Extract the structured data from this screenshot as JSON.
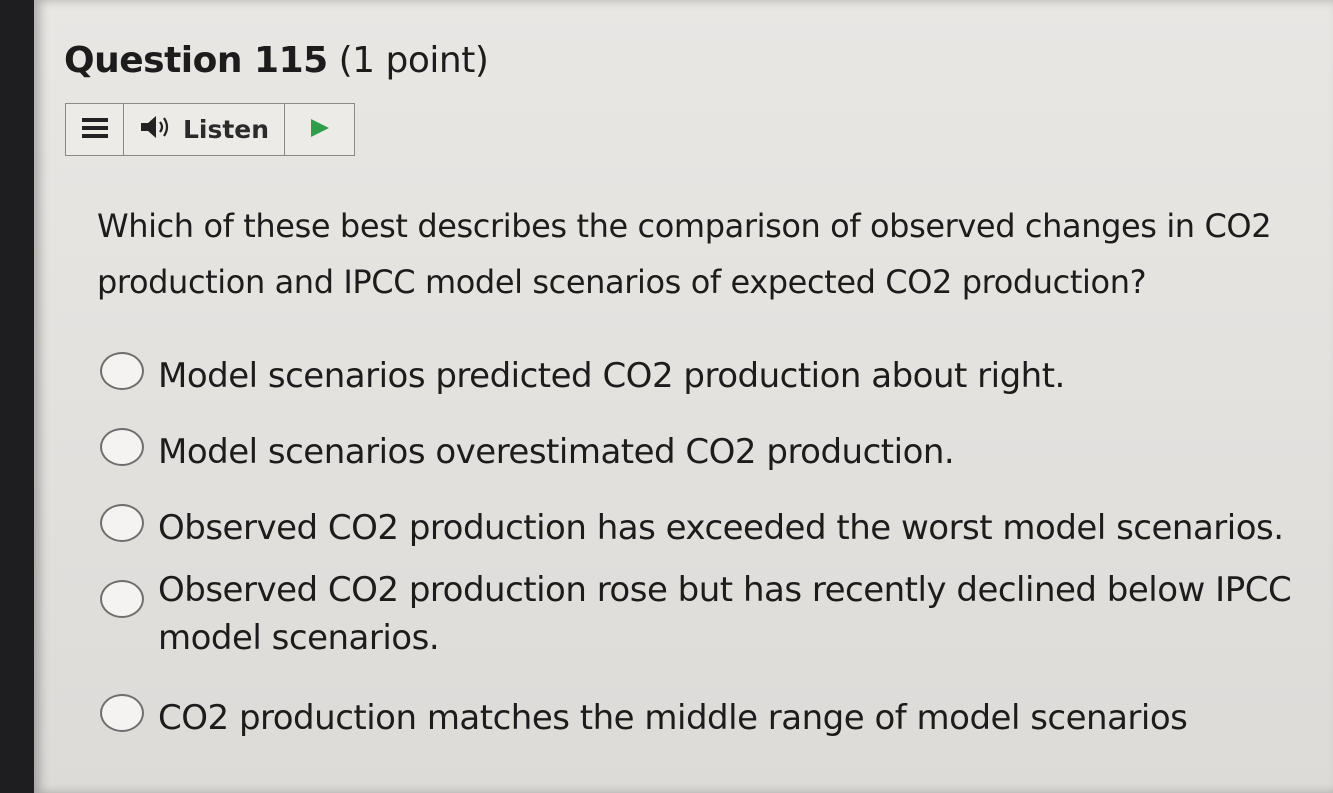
{
  "question": {
    "title": "Question 115",
    "points": "(1 point)",
    "text": "Which of these best describes the comparison of observed changes in CO2 production and IPCC model scenarios of expected CO2 production?"
  },
  "toolbar": {
    "listen_label": "Listen"
  },
  "options": [
    "Model scenarios predicted CO2 production about right.",
    "Model scenarios overestimated CO2 production.",
    "Observed CO2 production has exceeded the worst model scenarios.",
    "Observed CO2 production rose but has recently declined below IPCC model scenarios.",
    "CO2 production matches the middle range of model scenarios"
  ],
  "icons": {
    "menu": "hamburger-icon",
    "speaker": "speaker-icon",
    "play": "play-icon"
  },
  "colors": {
    "play_arrow": "#2e9e4a",
    "page_background": "#e6e4e1"
  }
}
